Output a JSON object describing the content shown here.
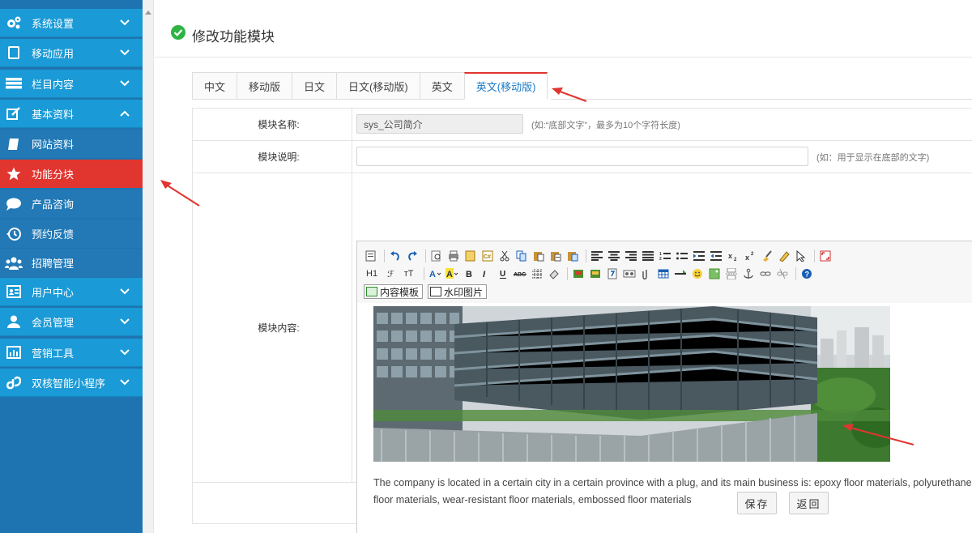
{
  "sidebar": {
    "items": [
      {
        "label": "系统设置",
        "icon": "gears-icon",
        "type": "top",
        "chevron": "down"
      },
      {
        "label": "移动应用",
        "icon": "mobile-icon",
        "type": "top",
        "chevron": "down"
      },
      {
        "label": "栏目内容",
        "icon": "server-icon",
        "type": "top",
        "chevron": "down"
      },
      {
        "label": "基本资料",
        "icon": "edit-icon",
        "type": "top",
        "chevron": "up"
      },
      {
        "label": "网站资料",
        "icon": "book-icon",
        "type": "sub"
      },
      {
        "label": "功能分块",
        "icon": "star-icon",
        "type": "active"
      },
      {
        "label": "产品咨询",
        "icon": "comment-icon",
        "type": "sub"
      },
      {
        "label": "预约反馈",
        "icon": "history-icon",
        "type": "sub"
      },
      {
        "label": "招聘管理",
        "icon": "users-icon",
        "type": "sub"
      },
      {
        "label": "用户中心",
        "icon": "id-card-icon",
        "type": "top",
        "chevron": "down"
      },
      {
        "label": "会员管理",
        "icon": "user-icon",
        "type": "top",
        "chevron": "down"
      },
      {
        "label": "营销工具",
        "icon": "bar-chart-icon",
        "type": "top",
        "chevron": "down"
      },
      {
        "label": "双核智能小程序",
        "icon": "miniprogram-icon",
        "type": "top",
        "chevron": "down"
      }
    ]
  },
  "header": {
    "title": "修改功能模块"
  },
  "tabs": [
    {
      "label": "中文"
    },
    {
      "label": "移动版"
    },
    {
      "label": "日文"
    },
    {
      "label": "日文(移动版)"
    },
    {
      "label": "英文"
    },
    {
      "label": "英文(移动版)",
      "active": true
    }
  ],
  "form": {
    "name_label": "模块名称:",
    "name_value": "sys_公司简介",
    "name_hint": "(如:“底部文字”，最多为10个字符长度)",
    "desc_label": "模块说明:",
    "desc_value": "",
    "desc_hint": "(如：用于显示在底部的文字)",
    "content_label": "模块内容:"
  },
  "editor": {
    "row2_text": [
      "H1",
      "ℱ",
      "тT"
    ],
    "template_button": "内容模板",
    "watermark_button": "水印图片",
    "content_text": "The company is located in a certain city in a certain province with a plug, and its main business is: epoxy floor materials, polyurethane floor materials, wear-resistant floor materials, embossed floor materials"
  },
  "buttons": {
    "save": "保存",
    "back": "返回"
  },
  "colors": {
    "sidebar_top": "#1a9ad6",
    "sidebar_sub": "#2279b6",
    "active": "#e1352f",
    "annotation_arrow": "#e1352f"
  }
}
